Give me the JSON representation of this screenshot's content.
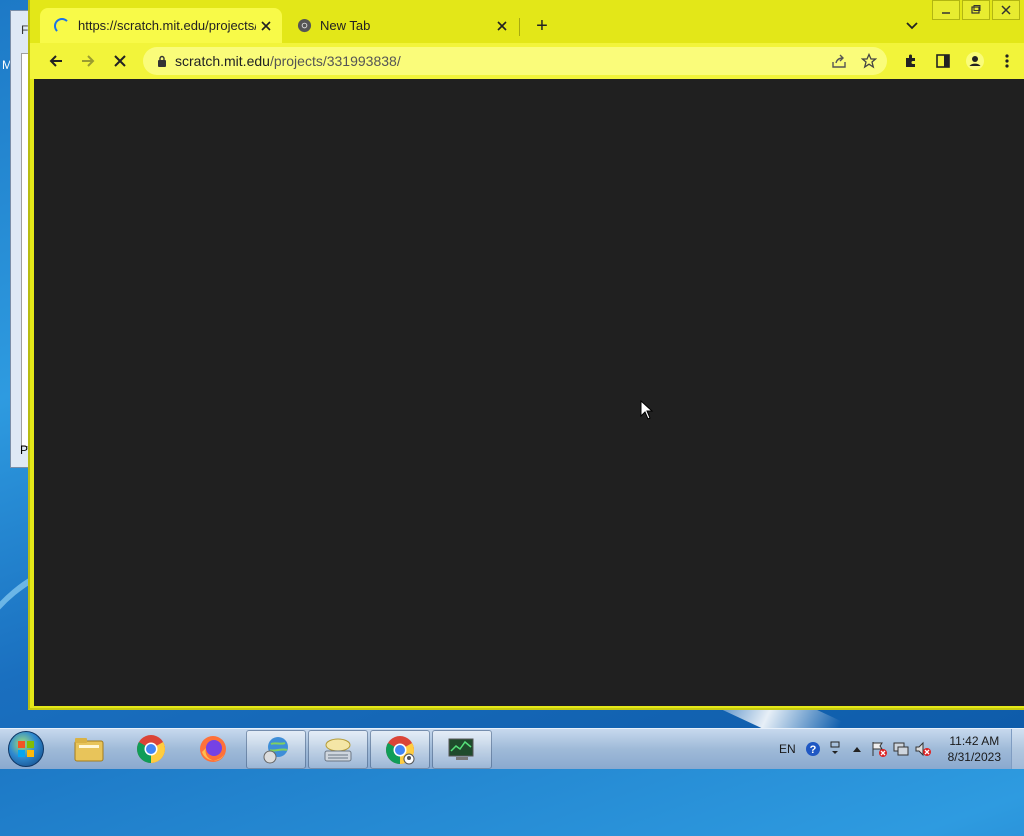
{
  "desktop": {
    "bg_window_top_text": "F",
    "bg_window_bottom_text": "P",
    "desktop_side_letter": "M"
  },
  "browser": {
    "tabs": [
      {
        "title": "https://scratch.mit.edu/projects/",
        "active": true,
        "loading": true
      },
      {
        "title": "New Tab",
        "active": false,
        "loading": false
      }
    ],
    "new_tab_label": "+",
    "address": {
      "host": "scratch.mit.edu",
      "path": "/projects/331993838/"
    },
    "theme_color": "#e3e718",
    "viewport_color": "#202020"
  },
  "taskbar": {
    "pinned": [
      "windows-explorer",
      "chrome",
      "firefox",
      "network-globe",
      "on-screen-keyboard",
      "chrome-active",
      "system-monitor"
    ],
    "tray": {
      "language": "EN",
      "time": "11:42 AM",
      "date": "8/31/2023"
    }
  }
}
